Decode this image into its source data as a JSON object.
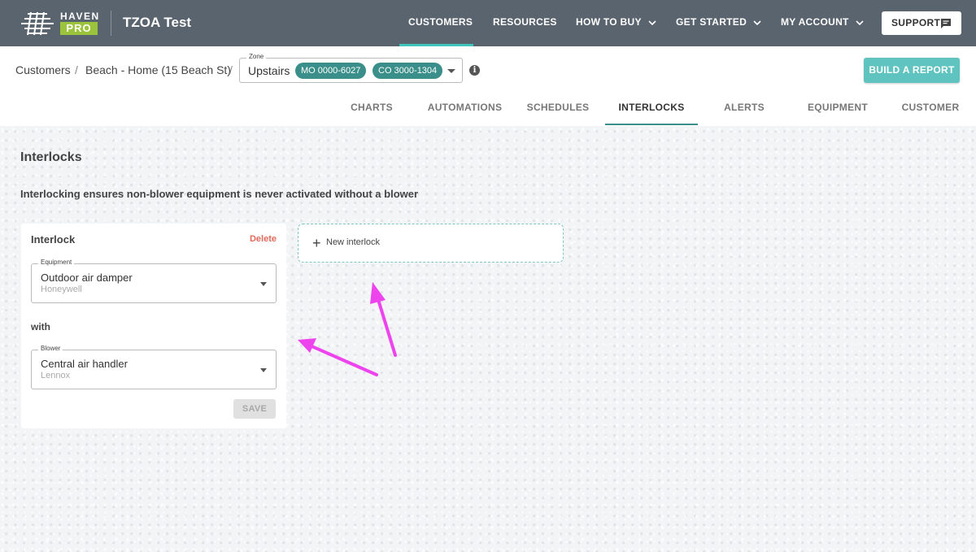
{
  "header": {
    "logo_word": "HAVEN",
    "logo_badge": "PRO",
    "site_name": "TZOA Test",
    "nav": [
      {
        "label": "CUSTOMERS",
        "active": true
      },
      {
        "label": "RESOURCES"
      },
      {
        "label": "HOW TO BUY",
        "dropdown": true
      },
      {
        "label": "GET STARTED",
        "dropdown": true
      },
      {
        "label": "MY ACCOUNT",
        "dropdown": true
      }
    ],
    "support_label": "SUPPORT",
    "accent_color": "#3fc4be",
    "logo_badge_color": "#9bc33b"
  },
  "breadcrumb": {
    "items": [
      "Customers",
      "Beach - Home (15 Beach St)"
    ],
    "separator": "/"
  },
  "zone": {
    "label": "Zone",
    "value": "Upstairs",
    "chips": [
      "MO 0000-6027",
      "CO 3000-1304"
    ]
  },
  "build_report_label": "BUILD A REPORT",
  "tabs": [
    {
      "label": "CHARTS"
    },
    {
      "label": "AUTOMATIONS"
    },
    {
      "label": "SCHEDULES"
    },
    {
      "label": "INTERLOCKS",
      "active": true
    },
    {
      "label": "ALERTS"
    },
    {
      "label": "EQUIPMENT"
    },
    {
      "label": "CUSTOMER"
    }
  ],
  "main": {
    "heading": "Interlocks",
    "description": "Interlocking ensures non-blower equipment is never activated without a blower",
    "interlock_card": {
      "title": "Interlock",
      "delete_label": "Delete",
      "equipment": {
        "label": "Equipment",
        "value": "Outdoor air damper",
        "sub": "Honeywell"
      },
      "with_label": "with",
      "blower": {
        "label": "Blower",
        "value": "Central air handler",
        "sub": "Lennox"
      },
      "save_label": "SAVE"
    },
    "new_interlock": {
      "plus": "+",
      "label": "New interlock"
    }
  },
  "annotation_color": "#ee44ee"
}
